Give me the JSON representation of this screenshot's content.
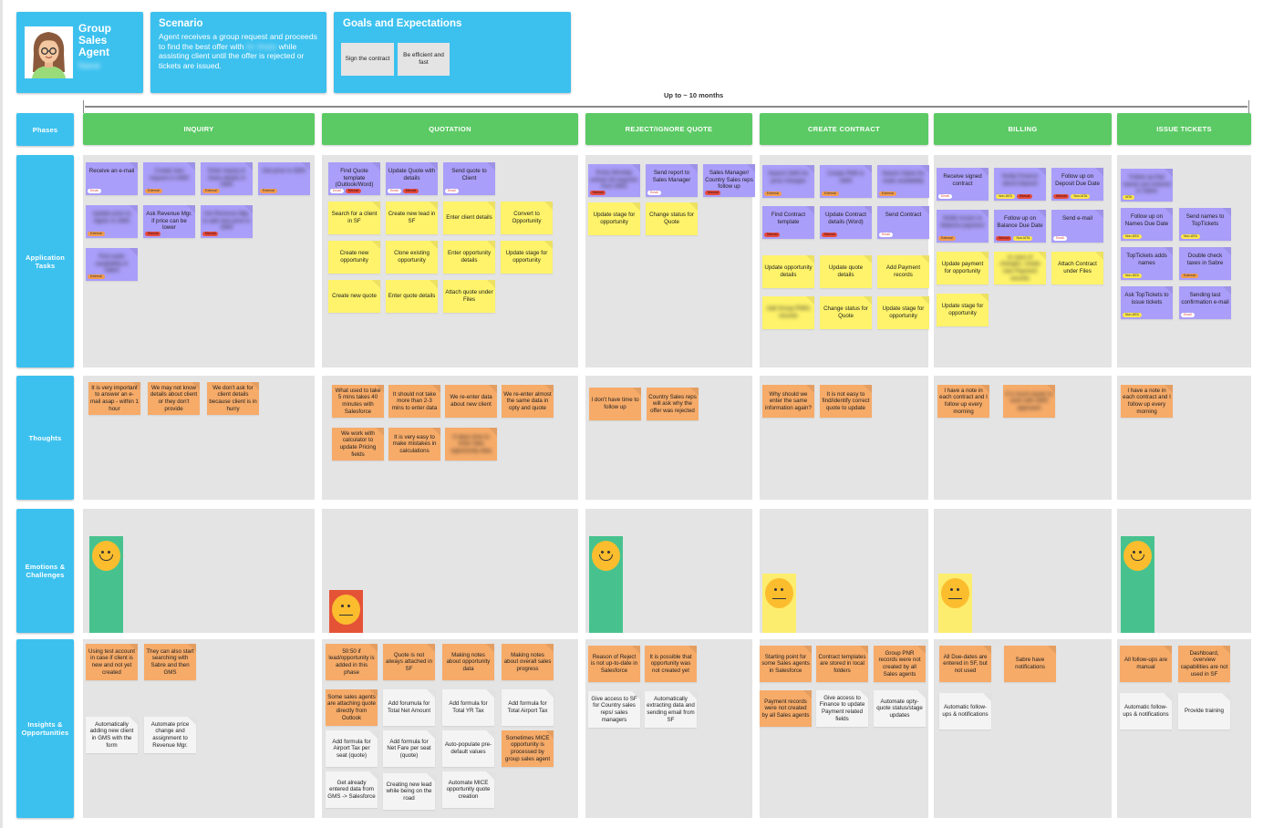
{
  "persona": {
    "title": "Group Sales Agent",
    "name": "Name"
  },
  "scenario": {
    "heading": "Scenario",
    "text_a": "Agent receives a group request and proceeds to find the best offer with ",
    "text_blur": "Air Malta",
    "text_b": " while assisting client until the offer is rejected or tickets are issued."
  },
  "goals": {
    "heading": "Goals and Expectations",
    "items": [
      "Sign the contract",
      "Be efficient and fast"
    ]
  },
  "timeline": {
    "label": "Up to ~ 10 months"
  },
  "row_labels": {
    "phases": "Phases",
    "tasks": "Application Tasks",
    "thoughts": "Thoughts",
    "emotions": "Emotions & Challenges",
    "insights": "Insights & Opportunities"
  },
  "phases": [
    "INQUIRY",
    "QUOTATION",
    "REJECT/IGNORE QUOTE",
    "CREATE CONTRACT",
    "BILLING",
    "ISSUE TICKETS"
  ],
  "colors": {
    "row_label_blue": "#3cc1ef",
    "phase_green": "#5bca64",
    "system_task_purple": "#a99ef9",
    "sf_task_yellow": "#fef36a",
    "pain_orange": "#f6ab69",
    "idea_white": "#f4f4f4",
    "emotion_happy": "#47c28f",
    "emotion_bad": "#e55337",
    "emotion_neutral": "#fded6e"
  },
  "tasks": {
    "inquiry": [
      {
        "text": "Receive an e-mail",
        "color": "purple",
        "tags": [
          "Email"
        ]
      },
      {
        "text": "Create new request in GMS",
        "color": "purple",
        "tags": [
          "External"
        ],
        "blurred": true
      },
      {
        "text": "Enter inquiry & share details in GMS",
        "color": "purple",
        "tags": [
          "External"
        ],
        "blurred": true
      },
      {
        "text": "Get price in GMS",
        "color": "purple",
        "tags": [
          "External"
        ],
        "blurred": true
      },
      {
        "text": "Update price to higher in GMS",
        "color": "purple",
        "tags": [
          "External"
        ],
        "blurred": true
      },
      {
        "text": "Ask Revenue Mgr. if price can be lower",
        "color": "purple",
        "tags": [
          "Manual"
        ]
      },
      {
        "text": "Ask Revenue Mgr. to add new price in GMS",
        "color": "purple",
        "tags": [
          "Manual"
        ],
        "blurred": true
      },
      {
        "text": "Find seats availability in Sabre",
        "color": "purple",
        "tags": [
          "External"
        ],
        "blurred": true
      }
    ],
    "quotation": [
      {
        "text": "Find Quote template (Outlook/Word)",
        "color": "purple",
        "tags": [
          "Email",
          "Manual"
        ]
      },
      {
        "text": "Update Quote with details",
        "color": "purple",
        "tags": [
          "Email",
          "Manual"
        ]
      },
      {
        "text": "Send quote to Client",
        "color": "purple",
        "tags": [
          "Email"
        ]
      },
      {
        "text": "Search for a client in SF",
        "color": "yellow"
      },
      {
        "text": "Create new lead in SF",
        "color": "yellow"
      },
      {
        "text": "Enter client details",
        "color": "yellow"
      },
      {
        "text": "Convert to Opportunity",
        "color": "yellow"
      },
      {
        "text": "Create new opportunity",
        "color": "yellow"
      },
      {
        "text": "Clone existing opportunity",
        "color": "yellow"
      },
      {
        "text": "Enter opportunity details",
        "color": "yellow"
      },
      {
        "text": "Update stage for opportunity",
        "color": "yellow"
      },
      {
        "text": "Create new quote",
        "color": "yellow"
      },
      {
        "text": "Enter quote details",
        "color": "yellow"
      },
      {
        "text": "Attach quote under Files",
        "color": "yellow"
      }
    ],
    "reject": [
      {
        "text": "Every Monday extract all requests from GMS",
        "color": "purple",
        "tags": [
          "Manual"
        ],
        "blurred": true
      },
      {
        "text": "Send report to Sales Manager",
        "color": "purple",
        "tags": [
          "Email"
        ]
      },
      {
        "text": "Sales Manager/ Country Sales reps follow up",
        "color": "purple",
        "tags": [
          "Manual"
        ]
      },
      {
        "text": "Update stage for opportunity",
        "color": "yellow"
      },
      {
        "text": "Change status for Quote",
        "color": "yellow"
      }
    ],
    "contract": [
      {
        "text": "Search GMS for price changes",
        "color": "purple",
        "tags": [
          "External"
        ],
        "blurred": true
      },
      {
        "text": "Create PNR in GMS",
        "color": "purple",
        "tags": [
          "External"
        ],
        "blurred": true
      },
      {
        "text": "Search Sabre for seats availability",
        "color": "purple",
        "tags": [
          "External"
        ],
        "blurred": true
      },
      {
        "text": "Find Contract template",
        "color": "purple",
        "tags": [
          "Manual"
        ]
      },
      {
        "text": "Update Contract details (Word)",
        "color": "purple",
        "tags": [
          "Manual"
        ]
      },
      {
        "text": "Send Contract",
        "color": "purple",
        "tags": [
          "Email"
        ]
      },
      {
        "text": "Update opportunity details",
        "color": "yellow"
      },
      {
        "text": "Update quote details",
        "color": "yellow"
      },
      {
        "text": "Add Payment records",
        "color": "yellow"
      },
      {
        "text": "Add Group PNRs records",
        "color": "yellow",
        "blurred": true
      },
      {
        "text": "Change status for Quote",
        "color": "yellow"
      },
      {
        "text": "Update stage for opportunity",
        "color": "yellow"
      }
    ],
    "billing": [
      {
        "text": "Receive signed contract",
        "color": "purple",
        "tags": [
          "Email"
        ]
      },
      {
        "text": "Notify Finance about Deposit",
        "color": "purple",
        "tags": [
          "Non-IATA",
          "Manual"
        ],
        "blurred": true
      },
      {
        "text": "Follow up on Deposit Due Date",
        "color": "purple",
        "tags": [
          "Manual",
          "Non-IATA"
        ]
      },
      {
        "text": "Notify Issues re Balance payment",
        "color": "purple",
        "tags": [
          "External"
        ],
        "blurred": true
      },
      {
        "text": "Follow up on Balance Due Date",
        "color": "purple",
        "tags": [
          "Manual",
          "Non-IATA"
        ]
      },
      {
        "text": "Send e-mail",
        "color": "purple",
        "tags": [
          "Email"
        ]
      },
      {
        "text": "Update payment for opportunity",
        "color": "yellow"
      },
      {
        "text": "In case of changes, create new Payment records",
        "color": "yellow",
        "blurred": true
      },
      {
        "text": "Attach Contract under Files",
        "color": "yellow"
      },
      {
        "text": "Update stage for opportunity",
        "color": "yellow"
      }
    ],
    "tickets": [
      {
        "text": "Follow up that names are entered in Sabre",
        "color": "purple",
        "tags": [
          "IATA"
        ],
        "blurred": true
      },
      {
        "text": "Follow up on Names Due Date",
        "color": "purple",
        "tags": [
          "Non-IATA"
        ]
      },
      {
        "text": "Send names to TopTickets",
        "color": "purple",
        "tags": [
          "Non-IATA"
        ]
      },
      {
        "text": "TopTickets adds names",
        "color": "purple",
        "tags": [
          "Non-IATA"
        ]
      },
      {
        "text": "Double check taxes in Sabre",
        "color": "purple",
        "tags": [
          "External"
        ]
      },
      {
        "text": "Ask TopTickets to issue tickets",
        "color": "purple",
        "tags": [
          "Non-IATA"
        ]
      },
      {
        "text": "Sending last confirmation e-mail",
        "color": "purple",
        "tags": [
          "Email"
        ]
      }
    ]
  },
  "thoughts": {
    "inquiry": [
      "It is very important to answer an e-mail asap - within 1 hour",
      "We may not know details about client or they don't provide",
      "We don't ask for client details because client is in hurry"
    ],
    "quotation": [
      "What used to take 5 mins takes 40 minutes with Salesforce",
      "It should not take more than 2-3 mins to enter data",
      "We re-enter data about new client",
      "We re-enter almost the same data in opty and quote",
      "We work with calculator to update Pricing fields",
      "It is very easy to make mistakes in calculations",
      {
        "text": "It takes time to enter data opportunity data",
        "blurred": true
      }
    ],
    "reject": [
      "I don't have time to follow up",
      "Country Sales reps will ask why the offer was rejected"
    ],
    "contract": [
      "Why should we enter the same information again?",
      "It is not easy to find/identify correct quote to update"
    ],
    "billing": [
      "I have a note in each contract and I follow up every morning",
      {
        "text": "It is much easier to work with GMS approach",
        "blurred": true
      }
    ],
    "tickets": [
      "I have a note in each contract and I follow up every morning"
    ]
  },
  "emotions": [
    {
      "phase": "INQUIRY",
      "mood": "happy",
      "level": 0.9
    },
    {
      "phase": "QUOTATION",
      "mood": "neutral",
      "level": 0.4,
      "color": "bad"
    },
    {
      "phase": "REJECT/IGNORE QUOTE",
      "mood": "happy",
      "level": 0.9
    },
    {
      "phase": "CREATE CONTRACT",
      "mood": "neutral",
      "level": 0.55,
      "color": "neutral"
    },
    {
      "phase": "BILLING",
      "mood": "neutral",
      "level": 0.55,
      "color": "neutral"
    },
    {
      "phase": "ISSUE TICKETS",
      "mood": "happy",
      "level": 0.9
    }
  ],
  "insights": {
    "inquiry": [
      {
        "text": "Using test account in case if client is new and not yet created",
        "color": "orange"
      },
      {
        "text": "They can also start searching with Sabre and then GMS",
        "color": "orange"
      },
      {
        "text": "Automatically adding new client in GMS with the form",
        "color": "white"
      },
      {
        "text": "Automate price change and assignment to Revenue Mgr.",
        "color": "white"
      }
    ],
    "quotation": [
      {
        "text": "50:50 if lead/opportunity is added in this phase",
        "color": "orange"
      },
      {
        "text": "Quote is not always attached in SF",
        "color": "orange"
      },
      {
        "text": "Making notes about opportunity data",
        "color": "orange"
      },
      {
        "text": "Making notes about overall sales progress",
        "color": "orange"
      },
      {
        "text": "Some sales agents are attaching quote directly from Outlook",
        "color": "orange"
      },
      {
        "text": "Add forumula for Total Net Amount",
        "color": "white"
      },
      {
        "text": "Add formula for Total YR Tax",
        "color": "white"
      },
      {
        "text": "Add formula for Total Airport Tax",
        "color": "white"
      },
      {
        "text": "Add formula for Airport Tax per seat (quote)",
        "color": "white"
      },
      {
        "text": "Add formula for Net Fare per seat (quote)",
        "color": "white"
      },
      {
        "text": "Auto-populate pre-default values",
        "color": "white"
      },
      {
        "text": "Sometimes MICE opportunity is processed by group sales agent",
        "color": "orange"
      },
      {
        "text": "Get already entered data from GMS -> Salesforce",
        "color": "white"
      },
      {
        "text": "Creating new lead while being on the road",
        "color": "white"
      },
      {
        "text": "Automate MICE opportunity quote creation",
        "color": "white"
      }
    ],
    "reject": [
      {
        "text": "Reason of Reject is not up-to-date in Salesforce",
        "color": "orange"
      },
      {
        "text": "It is possible that opportunity was not created yet",
        "color": "orange"
      },
      {
        "text": "Give access to SF for Country sales reps/ sales managers",
        "color": "white"
      },
      {
        "text": "Automatically extracting data and sending email from SF",
        "color": "white"
      }
    ],
    "contract": [
      {
        "text": "Starting point for some Sales agents in Salesforce",
        "color": "orange"
      },
      {
        "text": "Contract templates are stored in local folders",
        "color": "orange"
      },
      {
        "text": "Group PNR records were not created by all Sales agents",
        "color": "orange"
      },
      {
        "text": "Payment records were not created by all Sales agents",
        "color": "orange"
      },
      {
        "text": "Give access to Finance to update Payment related fields",
        "color": "white"
      },
      {
        "text": "Automate opty-quote status/stage updates",
        "color": "white"
      }
    ],
    "billing": [
      {
        "text": "All Due-dates are entered in SF, but not used",
        "color": "orange"
      },
      {
        "text": "Sabre have notifications",
        "color": "orange"
      },
      {
        "text": "Automatic follow-ups & notifications",
        "color": "white"
      }
    ],
    "tickets": [
      {
        "text": "All follow-ups are manual",
        "color": "orange"
      },
      {
        "text": "Dashboard, overview capabilities are not used in SF",
        "color": "orange"
      },
      {
        "text": "Automatic follow-ups & notifications",
        "color": "white"
      },
      {
        "text": "Provide training",
        "color": "white"
      }
    ]
  }
}
